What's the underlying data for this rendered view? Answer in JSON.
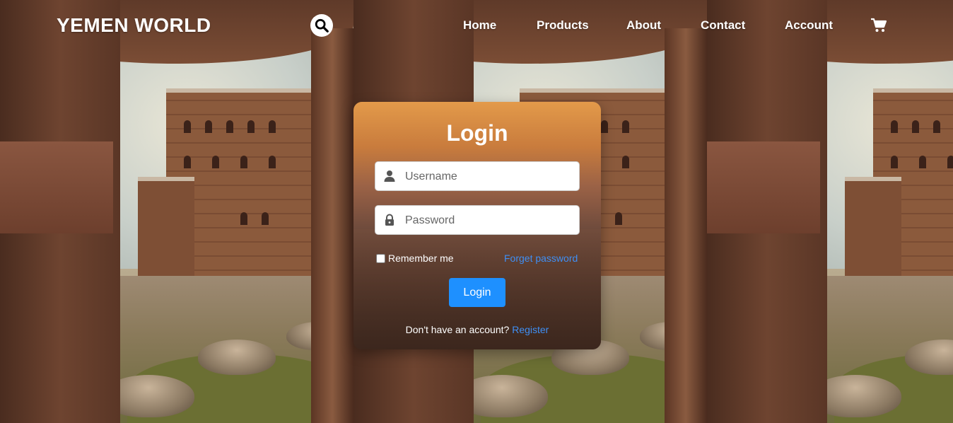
{
  "header": {
    "brand": "YEMEN WORLD",
    "search_icon": "search-icon",
    "nav": [
      {
        "label": "Home"
      },
      {
        "label": "Products"
      },
      {
        "label": "About"
      },
      {
        "label": "Contact"
      },
      {
        "label": "Account"
      }
    ],
    "cart_icon": "cart-icon"
  },
  "login": {
    "title": "Login",
    "username": {
      "placeholder": "Username",
      "value": "",
      "icon": "user-icon"
    },
    "password": {
      "placeholder": "Password",
      "value": "",
      "icon": "lock-icon"
    },
    "remember_label": "Remember me",
    "remember_checked": false,
    "forgot_label": "Forget password",
    "submit_label": "Login",
    "register_prompt": "Don't have an account?",
    "register_link": "Register"
  },
  "colors": {
    "accent": "#1e90ff",
    "link": "#3f8ff4",
    "text_light": "#ffffff"
  }
}
